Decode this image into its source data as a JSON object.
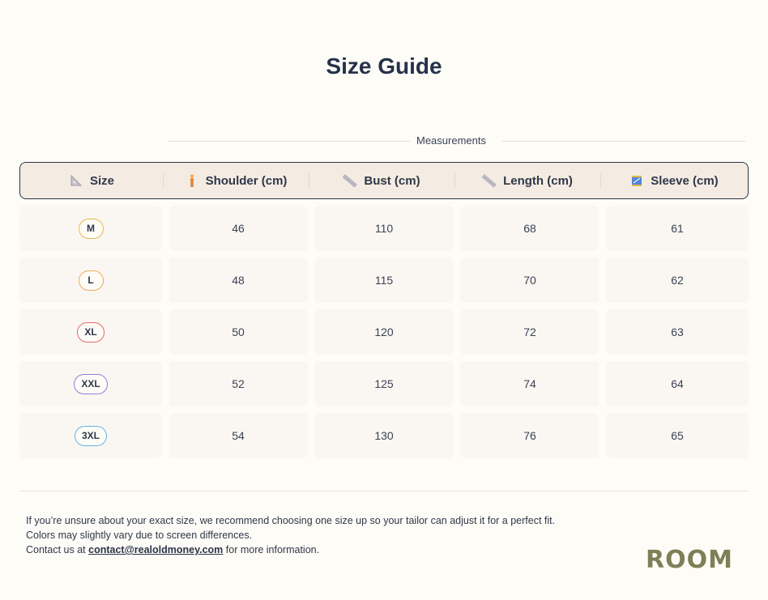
{
  "page": {
    "title": "Size Guide"
  },
  "measurements_label": "Measurements",
  "columns": [
    {
      "label": "Size",
      "icon": "triangle-ruler-icon"
    },
    {
      "label": "Shoulder (cm)",
      "icon": "person-icon"
    },
    {
      "label": "Bust (cm)",
      "icon": "ruler-icon"
    },
    {
      "label": "Length (cm)",
      "icon": "ruler-icon"
    },
    {
      "label": "Sleeve (cm)",
      "icon": "sewing-icon"
    }
  ],
  "rows": [
    {
      "size": "M",
      "badge_color": "#e8b84a",
      "shoulder": "46",
      "bust": "110",
      "length": "68",
      "sleeve": "61"
    },
    {
      "size": "L",
      "badge_color": "#eea75a",
      "shoulder": "48",
      "bust": "115",
      "length": "70",
      "sleeve": "62"
    },
    {
      "size": "XL",
      "badge_color": "#e36a6a",
      "shoulder": "50",
      "bust": "120",
      "length": "72",
      "sleeve": "63"
    },
    {
      "size": "XXL",
      "badge_color": "#8d7fd9",
      "shoulder": "52",
      "bust": "125",
      "length": "74",
      "sleeve": "64"
    },
    {
      "size": "3XL",
      "badge_color": "#5fb6e6",
      "shoulder": "54",
      "bust": "130",
      "length": "76",
      "sleeve": "65"
    }
  ],
  "notes": {
    "line1": "If you’re unsure about your exact size, we recommend choosing one size up so your tailor can adjust it for a perfect fit.",
    "line2": "Colors may slightly vary due to screen differences.",
    "line3_prefix": "Contact us at ",
    "email": "contact@realoldmoney.com",
    "line3_suffix": " for more information."
  },
  "brand": {
    "logo_text": "ROOM",
    "color": "#7d8057"
  }
}
